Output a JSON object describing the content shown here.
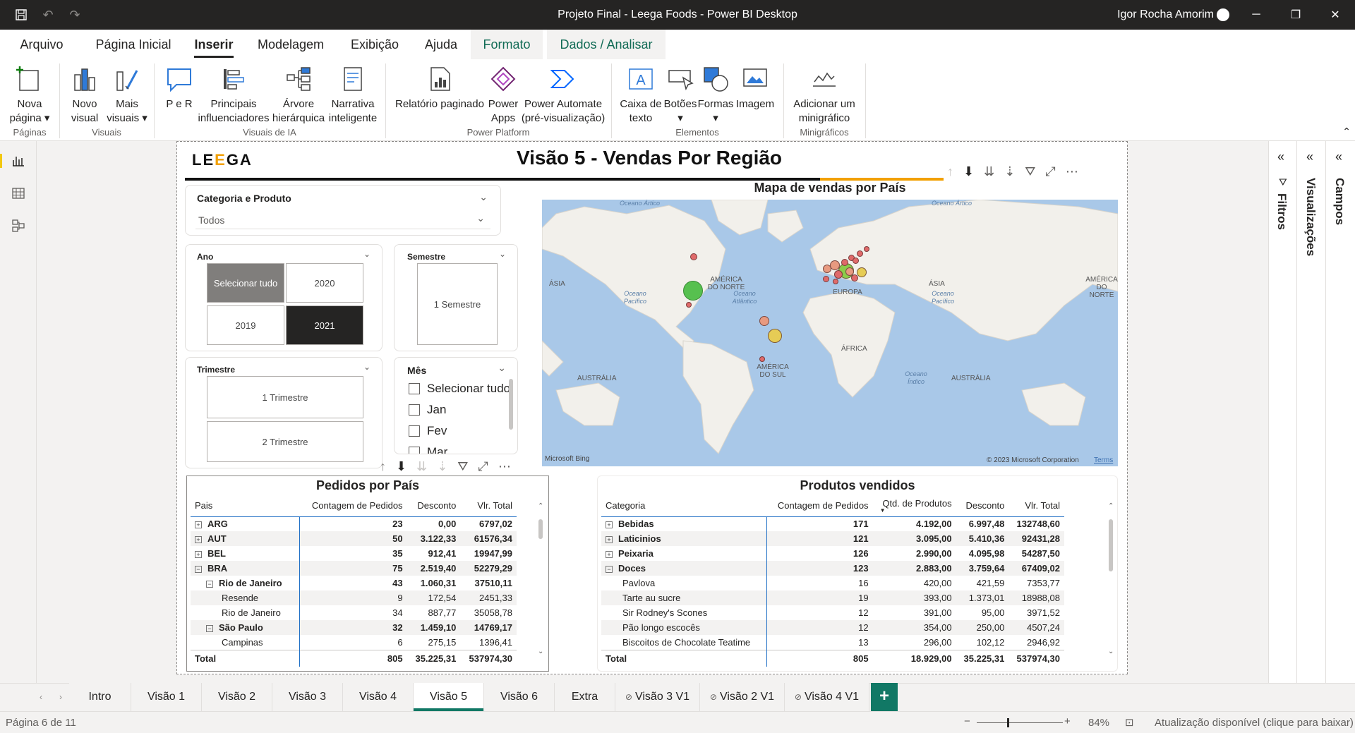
{
  "window": {
    "title": "Projeto Final - Leega Foods - Power BI Desktop",
    "user": "Igor Rocha Amorim"
  },
  "menu": [
    "Arquivo",
    "Página Inicial",
    "Inserir",
    "Modelagem",
    "Exibição",
    "Ajuda",
    "Formato",
    "Dados / Analisar"
  ],
  "ribbon": {
    "nova_pagina": "Nova página",
    "novo_visual": "Novo visual",
    "mais_visuais": "Mais visuais",
    "pr": "P e R",
    "principais": "Principais influenciadores",
    "arvore": "Árvore hierárquica",
    "narrativa": "Narrativa inteligente",
    "relatorio": "Relatório paginado",
    "power_apps": "Power Apps",
    "power_automate": "Power Automate (pré-visualização)",
    "caixa": "Caixa de texto",
    "botoes": "Botões",
    "formas": "Formas",
    "imagem": "Imagem",
    "minigrafico": "Adicionar um minigráfico",
    "groups": {
      "paginas": "Páginas",
      "visuais": "Visuais",
      "ia": "Visuais de IA",
      "power": "Power Platform",
      "elementos": "Elementos",
      "mini": "Minigráficos"
    }
  },
  "report": {
    "logo_a": "LE",
    "logo_b": "E",
    "logo_c": "GA",
    "title": "Visão 5 - Vendas Por Região",
    "slicer_cat": {
      "title": "Categoria e Produto",
      "value": "Todos"
    },
    "slicer_ano": {
      "title": "Ano",
      "items": [
        "Selecionar tudo",
        "2020",
        "2019",
        "2021"
      ]
    },
    "slicer_sem": {
      "title": "Semestre",
      "items": [
        "1 Semestre"
      ]
    },
    "slicer_tri": {
      "title": "Trimestre",
      "items": [
        "1 Trimestre",
        "2 Trimestre"
      ]
    },
    "slicer_mes": {
      "title": "Mês",
      "items": [
        "Selecionar tudo",
        "Jan",
        "Fev",
        "Mar"
      ]
    },
    "map": {
      "title": "Mapa de vendas por País",
      "labels": [
        "AMÉRICA DO NORTE",
        "EUROPA",
        "ÁSIA",
        "ÁSIA",
        "ÁFRICA",
        "AMÉRICA DO SUL",
        "AUSTRÁLIA",
        "AUSTRÁLIA",
        "AMÉRICA DO NORTE"
      ],
      "oceans": [
        "Oceano Ártico",
        "Oceano Ártico",
        "Oceano Pacífico",
        "Oceano Atlântico",
        "Oceano Pacífico",
        "Oceano Índico"
      ],
      "bing": "Microsoft Bing",
      "copyright": "© 2023 Microsoft Corporation",
      "terms": "Terms"
    },
    "pedidos": {
      "title": "Pedidos por País",
      "headers": [
        "Pais",
        "Contagem de Pedidos",
        "Desconto",
        "Vlr. Total"
      ],
      "rows": [
        {
          "lvl": 0,
          "exp": "+",
          "name": "ARG",
          "a": "23",
          "b": "0,00",
          "c": "6797,02"
        },
        {
          "lvl": 0,
          "exp": "+",
          "name": "AUT",
          "a": "50",
          "b": "3.122,33",
          "c": "61576,34"
        },
        {
          "lvl": 0,
          "exp": "+",
          "name": "BEL",
          "a": "35",
          "b": "912,41",
          "c": "19947,99"
        },
        {
          "lvl": 0,
          "exp": "−",
          "name": "BRA",
          "a": "75",
          "b": "2.519,40",
          "c": "52279,29"
        },
        {
          "lvl": 1,
          "exp": "−",
          "name": "Rio de Janeiro",
          "a": "43",
          "b": "1.060,31",
          "c": "37510,11"
        },
        {
          "lvl": 2,
          "exp": "",
          "name": "Resende",
          "a": "9",
          "b": "172,54",
          "c": "2451,33"
        },
        {
          "lvl": 2,
          "exp": "",
          "name": "Rio de Janeiro",
          "a": "34",
          "b": "887,77",
          "c": "35058,78"
        },
        {
          "lvl": 1,
          "exp": "−",
          "name": "São Paulo",
          "a": "32",
          "b": "1.459,10",
          "c": "14769,17"
        },
        {
          "lvl": 2,
          "exp": "",
          "name": "Campinas",
          "a": "6",
          "b": "275,15",
          "c": "1396,41"
        }
      ],
      "total": {
        "name": "Total",
        "a": "805",
        "b": "35.225,31",
        "c": "537974,30"
      }
    },
    "produtos": {
      "title": "Produtos vendidos",
      "headers": [
        "Categoria",
        "Contagem de Pedidos",
        "Qtd. de Produtos",
        "Desconto",
        "Vlr. Total"
      ],
      "rows": [
        {
          "lvl": 0,
          "exp": "+",
          "name": "Bebidas",
          "a": "171",
          "q": "4.192,00",
          "b": "6.997,48",
          "c": "132748,60"
        },
        {
          "lvl": 0,
          "exp": "+",
          "name": "Laticinios",
          "a": "121",
          "q": "3.095,00",
          "b": "5.410,36",
          "c": "92431,28"
        },
        {
          "lvl": 0,
          "exp": "+",
          "name": "Peixaria",
          "a": "126",
          "q": "2.990,00",
          "b": "4.095,98",
          "c": "54287,50"
        },
        {
          "lvl": 0,
          "exp": "−",
          "name": "Doces",
          "a": "123",
          "q": "2.883,00",
          "b": "3.759,64",
          "c": "67409,02"
        },
        {
          "lvl": 1,
          "exp": "",
          "name": "Pavlova",
          "a": "16",
          "q": "420,00",
          "b": "421,59",
          "c": "7353,77"
        },
        {
          "lvl": 1,
          "exp": "",
          "name": "Tarte au sucre",
          "a": "19",
          "q": "393,00",
          "b": "1.373,01",
          "c": "18988,08"
        },
        {
          "lvl": 1,
          "exp": "",
          "name": "Sir Rodney's Scones",
          "a": "12",
          "q": "391,00",
          "b": "95,00",
          "c": "3971,52"
        },
        {
          "lvl": 1,
          "exp": "",
          "name": "Pão longo escocês",
          "a": "12",
          "q": "354,00",
          "b": "250,00",
          "c": "4507,24"
        },
        {
          "lvl": 1,
          "exp": "",
          "name": "Biscoitos de Chocolate Teatime",
          "a": "13",
          "q": "296,00",
          "b": "102,12",
          "c": "2946,92"
        }
      ],
      "total": {
        "name": "Total",
        "a": "805",
        "q": "18.929,00",
        "b": "35.225,31",
        "c": "537974,30"
      }
    }
  },
  "panes": {
    "filtros": "Filtros",
    "visualizacoes": "Visualizações",
    "campos": "Campos"
  },
  "tabs": [
    "Intro",
    "Visão 1",
    "Visão 2",
    "Visão 3",
    "Visão 4",
    "Visão 5",
    "Visão 6",
    "Extra",
    "Visão 3 V1",
    "Visão 2 V1",
    "Visão 4 V1"
  ],
  "status": {
    "page": "Página 6 de 11",
    "zoom": "84%",
    "update": "Atualização disponível (clique para baixar)"
  },
  "colors": {
    "accent": "#117865",
    "brand": "#f2c811",
    "dark": "#252423"
  }
}
